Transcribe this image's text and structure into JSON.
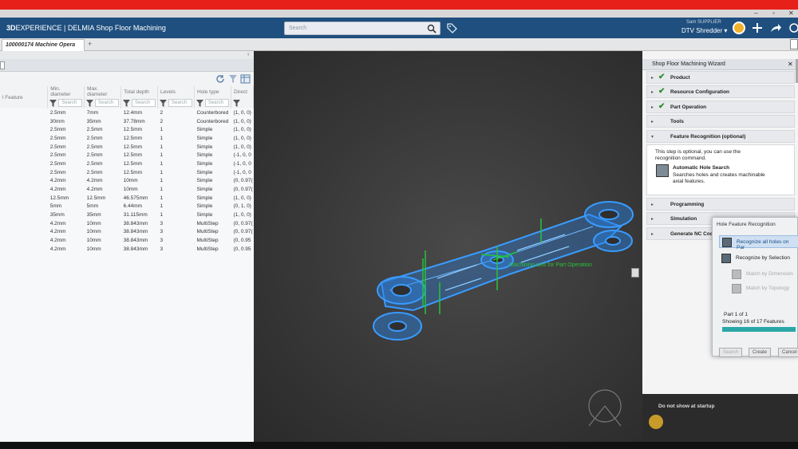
{
  "window": {
    "minimize": "–",
    "restore": "▫",
    "close": "✕"
  },
  "header": {
    "brand_bold": "3D",
    "brand_rest": "EXPERIENCE | DELMIA Shop Floor Machining",
    "search_placeholder": "Search",
    "user_name": "Sam SUPPLIER",
    "tenant": "DTV Shredder ▾"
  },
  "tabs": [
    {
      "label": "100000174 Machine Opera"
    }
  ],
  "tab_add": "+",
  "left_panel": {
    "columns": [
      "l Feature",
      "Min. diameter",
      "Max. diameter",
      "Total depth",
      "Levels",
      "Hole type",
      "Direct"
    ],
    "search_placeholder": "Search",
    "rows": [
      [
        "2.5mm",
        "7mm",
        "12.4mm",
        "2",
        "Counterbored",
        "(1, 0, 0)"
      ],
      [
        "30mm",
        "35mm",
        "37.78mm",
        "2",
        "Counterbored",
        "(1, 0, 0)"
      ],
      [
        "2.5mm",
        "2.5mm",
        "12.5mm",
        "1",
        "Simple",
        "(1, 0, 0)"
      ],
      [
        "2.5mm",
        "2.5mm",
        "12.5mm",
        "1",
        "Simple",
        "(1, 0, 0)"
      ],
      [
        "2.5mm",
        "2.5mm",
        "12.5mm",
        "1",
        "Simple",
        "(1, 0, 0)"
      ],
      [
        "2.5mm",
        "2.5mm",
        "12.5mm",
        "1",
        "Simple",
        "(-1, 0, 0"
      ],
      [
        "2.5mm",
        "2.5mm",
        "12.5mm",
        "1",
        "Simple",
        "(-1, 0, 0"
      ],
      [
        "2.5mm",
        "2.5mm",
        "12.5mm",
        "1",
        "Simple",
        "(-1, 0, 0"
      ],
      [
        "4.2mm",
        "4.2mm",
        "10mm",
        "1",
        "Simple",
        "(0, 0.97("
      ],
      [
        "4.2mm",
        "4.2mm",
        "10mm",
        "1",
        "Simple",
        "(0, 0.97("
      ],
      [
        "12.5mm",
        "12.5mm",
        "46.575mm",
        "1",
        "Simple",
        "(1, 0, 0)"
      ],
      [
        "5mm",
        "5mm",
        "6.44mm",
        "1",
        "Simple",
        "(0, 1, 0)"
      ],
      [
        "35mm",
        "35mm",
        "31.115mm",
        "1",
        "Simple",
        "(1, 0, 0)"
      ],
      [
        "4.2mm",
        "10mm",
        "38.843mm",
        "3",
        "MultiStep",
        "(0, 0.97("
      ],
      [
        "4.2mm",
        "10mm",
        "38.843mm",
        "3",
        "MultiStep",
        "(0, 0.97("
      ],
      [
        "4.2mm",
        "10mm",
        "38.843mm",
        "3",
        "MultiStep",
        "(0, 0.95"
      ],
      [
        "4.2mm",
        "10mm",
        "38.843mm",
        "3",
        "MultiStep",
        "(0, 0.95"
      ]
    ]
  },
  "viewport": {
    "label": "Machining axis for Part Operation"
  },
  "wizard": {
    "title": "Shop Floor Machining Wizard",
    "steps": [
      {
        "label": "Product",
        "done": true
      },
      {
        "label": "Resource Configuration",
        "done": true
      },
      {
        "label": "Part Operation",
        "done": true
      },
      {
        "label": "Tools",
        "done": false
      },
      {
        "label": "Feature Recognition (optional)",
        "done": false
      }
    ],
    "feature_recognition": {
      "description": "This step is optional, you can use the recognition command.",
      "command_title": "Automatic Hole Search",
      "command_desc": "Searches holes and creates machinable axial features."
    },
    "lower_steps": [
      {
        "label": "Programming"
      },
      {
        "label": "Simulation"
      },
      {
        "label": "Generate NC Code"
      }
    ],
    "dont_show": "Do not show at startup"
  },
  "popup": {
    "title": "Hole Feature Recognition",
    "options": [
      "Recognize all holes on Par",
      "Recognize by Selection",
      "Match by Dimension",
      "Match by Topology"
    ],
    "part_info": "Part 1 of 1",
    "features_info": "Showing 16 of 17 Features",
    "progress": 1.0,
    "buttons": [
      "Search",
      "Create",
      "Cancel"
    ]
  },
  "colors": {
    "header_bg": "#1f4f7e",
    "red_bar": "#e8201a",
    "model_blue": "#3a9bff",
    "check_green": "#2d8d2d",
    "progress": "#2aa7a7"
  }
}
